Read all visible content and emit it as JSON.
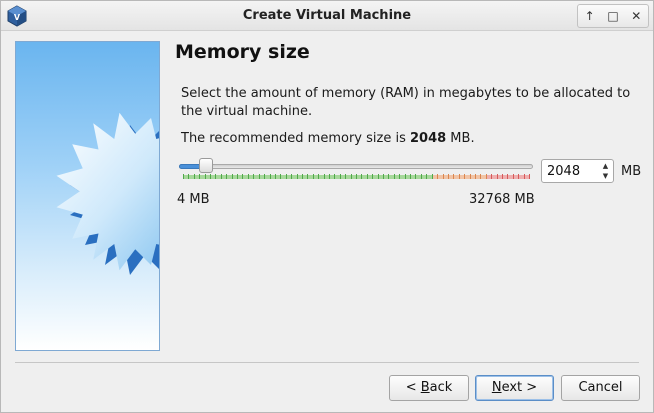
{
  "window": {
    "title": "Create Virtual Machine",
    "app_icon": "virtualbox-icon",
    "controls": [
      {
        "name": "minimize-icon",
        "glyph": "↑"
      },
      {
        "name": "maximize-icon",
        "glyph": "□"
      },
      {
        "name": "close-icon",
        "glyph": "✕"
      }
    ]
  },
  "page": {
    "title": "Memory size",
    "description": "Select the amount of memory (RAM) in megabytes to be allocated to the virtual machine.",
    "recommend_prefix": "The recommended memory size is ",
    "recommend_value": "2048",
    "recommend_suffix": " MB."
  },
  "memory": {
    "value": "2048",
    "unit": "MB",
    "min_label": "4 MB",
    "max_label": "32768 MB",
    "min": 4,
    "max": 32768,
    "current": 2048,
    "handle_fraction": 0.077,
    "zones": {
      "green_end_fraction": 0.72,
      "orange_end_fraction": 0.88
    },
    "colors": {
      "green": "#8fd07f",
      "orange": "#f1b58e",
      "red": "#ef9a9a",
      "fill": "#4a90d9"
    }
  },
  "buttons": {
    "back_prefix": "< ",
    "back_mnemonic": "B",
    "back_rest": "ack",
    "next_mnemonic": "N",
    "next_rest": "ext >",
    "cancel": "Cancel"
  }
}
